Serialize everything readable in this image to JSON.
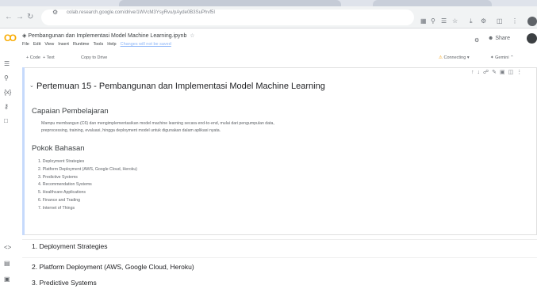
{
  "browser": {
    "url": "colab.research.google.com/drive/1WVcM3YsyRvu/pAyde0B3SuPhvf5I",
    "back_icon": "arrow-left-icon",
    "forward_icon": "arrow-right-icon",
    "reload_icon": "reload-icon"
  },
  "colab": {
    "logo": "CO",
    "notebook_title": "◈ Pembangunan dan Implementasi Model Machine Learning.ipynb",
    "star_icon": "☆",
    "menu": [
      "File",
      "Edit",
      "View",
      "Insert",
      "Runtime",
      "Tools",
      "Help"
    ],
    "saved_status": "Changes will not be saved",
    "share_label": "Share",
    "code_button": "+ Code",
    "text_button": "+ Text",
    "copy_button": "Copy to Drive",
    "connecting_label": "Connecting",
    "gemini_label": "Gemini"
  },
  "cell": {
    "title": "Pertemuan 15 - Pembangunan dan Implementasi Model Machine Learning",
    "heading_capaian": "Capaian Pembelajaran",
    "capaian_text_1": "Mampu membangun (C6) dan mengimplementasikan model machine learning secara end-to-end, mulai dari pengumpulan data,",
    "capaian_text_2": "preprocessing, training, evaluasi, hingga deployment model untuk digunakan dalam aplikasi nyata.",
    "heading_pokok": "Pokok Bahasan",
    "topics": [
      "1. Deployment Strategies",
      "2. Platform Deployment (AWS, Google Cloud, Heroku)",
      "3. Predictive Systems",
      "4. Recommendation Systems",
      "5. Healthcare Applications",
      "6. Finance and Trading",
      "7. Internet of Things"
    ]
  },
  "sections": [
    "1. Deployment Strategies",
    "2. Platform Deployment (AWS, Google Cloud, Heroku)",
    "3. Predictive Systems"
  ]
}
